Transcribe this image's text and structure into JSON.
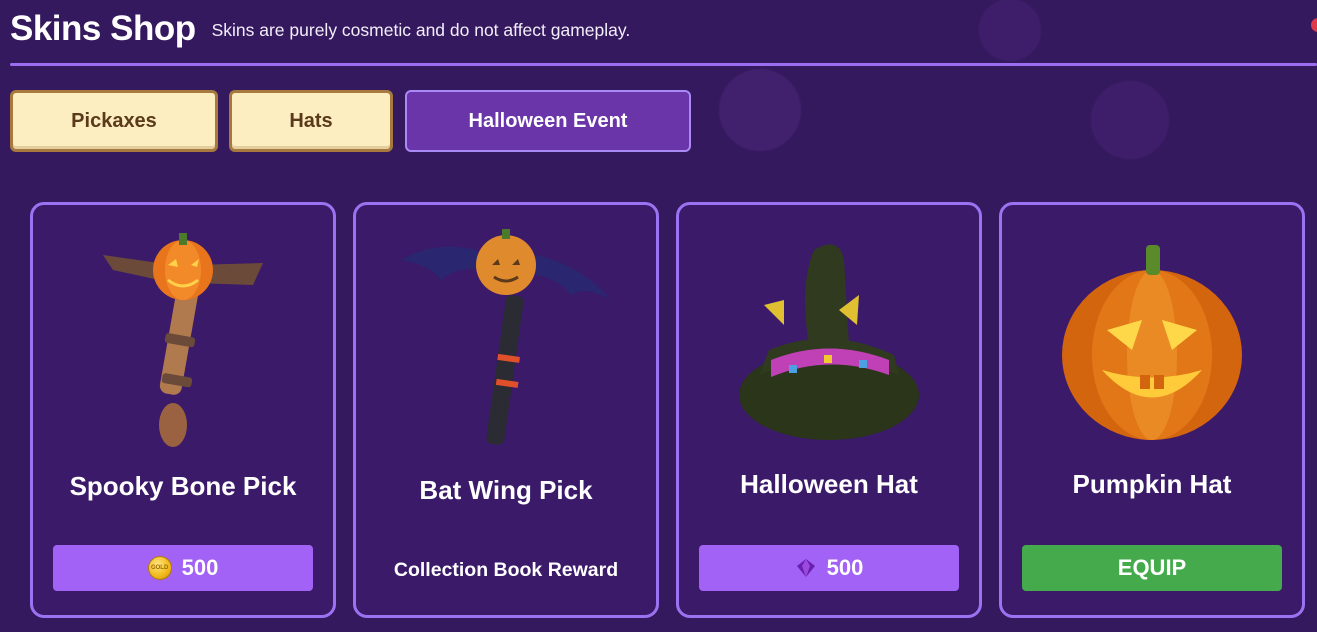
{
  "header": {
    "title": "Skins Shop",
    "subtitle": "Skins are purely cosmetic and do not affect gameplay."
  },
  "tabs": [
    {
      "label": "Pickaxes",
      "active": false
    },
    {
      "label": "Hats",
      "active": false
    },
    {
      "label": "Halloween Event",
      "active": true
    }
  ],
  "items": [
    {
      "name": "Spooky Bone Pick",
      "price": "500",
      "currency": "coin-icon",
      "coin_text": "GOLD"
    },
    {
      "name": "Bat Wing Pick",
      "reward": "Collection Book Reward"
    },
    {
      "name": "Halloween Hat",
      "price": "500",
      "currency": "gem-icon"
    },
    {
      "name": "Pumpkin Hat",
      "action": "EQUIP"
    }
  ],
  "colors": {
    "background": "#35195e",
    "card_border": "#9b73f2",
    "price_button": "#a262f5",
    "equip_button": "#44aa4c",
    "tab_inactive": "#fdeec2",
    "tab_active": "#6a35a8"
  }
}
